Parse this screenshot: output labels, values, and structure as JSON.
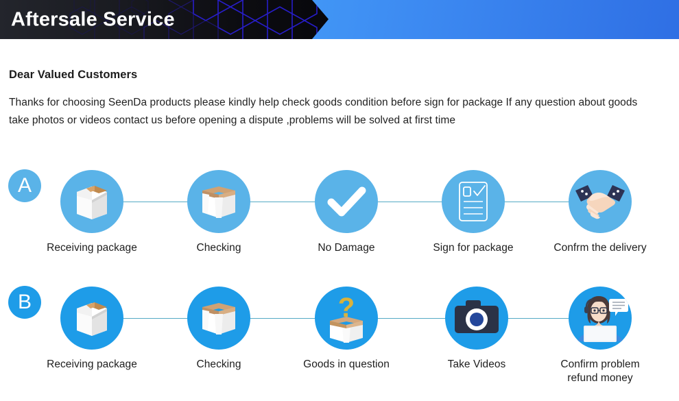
{
  "header": {
    "title": "Aftersale Service",
    "accent_blue": "#4da2fb",
    "dark": "#0d0d12",
    "hex_outline": "#2a1fd4"
  },
  "intro": {
    "salutation": "Dear Valued Customers",
    "paragraph": "Thanks for choosing SeenDa products please kindly help check goods condition before sign for package If any question about goods take photos or videos contact us before opening a dispute ,problems will be solved at first time"
  },
  "colors": {
    "row_a_circle": "#5ab3e8",
    "row_b_circle": "#1e9ce8",
    "connector": "#54a9c4",
    "label_text": "#1e1e1e",
    "question_mark": "#d9b23c",
    "camera_body": "#2b3246",
    "cuff_navy": "#2d3354",
    "skin": "#f6d6bd"
  },
  "rows": [
    {
      "badge": "A",
      "steps": [
        {
          "label": "Receiving package",
          "icon": "closed-box-icon"
        },
        {
          "label": "Checking",
          "icon": "open-box-icon"
        },
        {
          "label": "No Damage",
          "icon": "checkmark-icon"
        },
        {
          "label": "Sign for package",
          "icon": "clipboard-signature-icon"
        },
        {
          "label": "Confrm the delivery",
          "icon": "handshake-icon"
        }
      ]
    },
    {
      "badge": "B",
      "steps": [
        {
          "label": "Receiving package",
          "icon": "closed-box-icon"
        },
        {
          "label": "Checking",
          "icon": "open-box-icon"
        },
        {
          "label": "Goods in question",
          "icon": "question-box-icon"
        },
        {
          "label": "Take Videos",
          "icon": "camera-icon"
        },
        {
          "label": "Confirm problem\nrefund money",
          "icon": "support-agent-icon"
        }
      ]
    }
  ]
}
